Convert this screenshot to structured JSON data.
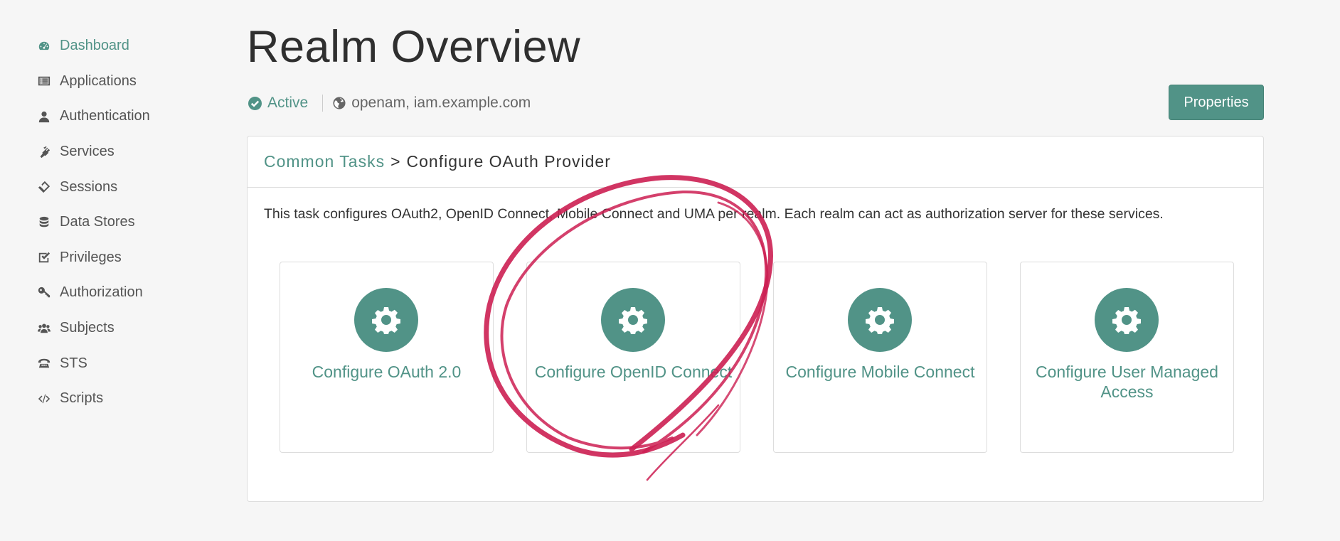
{
  "sidebar": {
    "items": [
      {
        "label": "Dashboard",
        "icon": "dashboard-icon",
        "active": true
      },
      {
        "label": "Applications",
        "icon": "applications-icon"
      },
      {
        "label": "Authentication",
        "icon": "user-icon"
      },
      {
        "label": "Services",
        "icon": "plug-icon"
      },
      {
        "label": "Sessions",
        "icon": "ticket-icon"
      },
      {
        "label": "Data Stores",
        "icon": "database-icon"
      },
      {
        "label": "Privileges",
        "icon": "checkbox-icon"
      },
      {
        "label": "Authorization",
        "icon": "key-icon"
      },
      {
        "label": "Subjects",
        "icon": "users-icon"
      },
      {
        "label": "STS",
        "icon": "phone-icon"
      },
      {
        "label": "Scripts",
        "icon": "code-icon"
      }
    ]
  },
  "header": {
    "title": "Realm Overview",
    "status": "Active",
    "hosts": "openam, iam.example.com",
    "properties_label": "Properties"
  },
  "panel": {
    "breadcrumb_link": "Common Tasks",
    "breadcrumb_sep": ">",
    "breadcrumb_current": "Configure OAuth Provider",
    "description": "This task configures OAuth2, OpenID Connect, Mobile Connect and UMA per realm. Each realm can act as authorization server for these services."
  },
  "cards": [
    {
      "label": "Configure OAuth 2.0",
      "icon": "gear-icon"
    },
    {
      "label": "Configure OpenID Connect",
      "icon": "gear-icon"
    },
    {
      "label": "Configure Mobile Connect",
      "icon": "gear-icon"
    },
    {
      "label": "Configure User Managed Access",
      "icon": "gear-icon"
    }
  ],
  "colors": {
    "accent": "#519387",
    "background": "#f6f6f6",
    "annotation": "#cc1f52"
  }
}
